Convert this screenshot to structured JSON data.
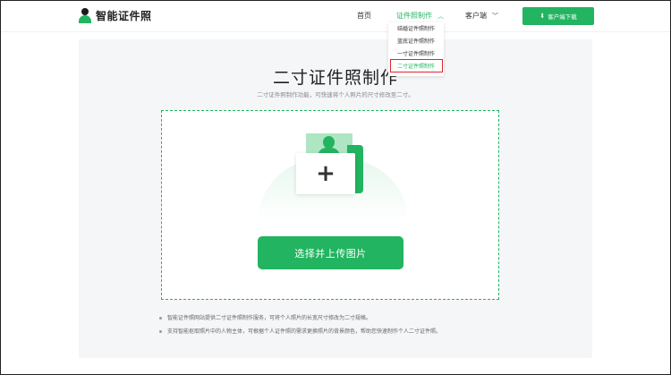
{
  "header": {
    "logo_text": "智能证件照",
    "nav": {
      "home": "首页",
      "id_photo_making": "证件照制作",
      "client": "客户端"
    },
    "download_button": "客户端下载"
  },
  "dropdown": {
    "options": [
      "结婚证件照制作",
      "蓝底证件照制作",
      "一寸证件照制作",
      "二寸证件照制作"
    ],
    "selected_index": 3
  },
  "main": {
    "title": "二寸证件照制作",
    "subtitle": "二寸证件照制作功能，可快速将个人照片的尺寸修改至二寸。",
    "upload_plus": "+",
    "upload_button": "选择并上传图片",
    "notes": [
      "智能证件照网站提供二寸证件照制作服务，可将个人照片的长宽尺寸修改为二寸规格。",
      "支持智能抠取照片中的人物主体，可根据个人证件照的需求更换照片的背景颜色，帮助您快速制作个人二寸证件照。"
    ]
  },
  "icons": {
    "logo": "person-logo-icon",
    "caret": "chevron-down-icon",
    "download": "download-icon",
    "upload_illustration": "photo-upload-icon"
  },
  "colors": {
    "accent": "#22b460",
    "highlight_border": "#e0242a",
    "panel_bg": "#f5f6f8"
  }
}
